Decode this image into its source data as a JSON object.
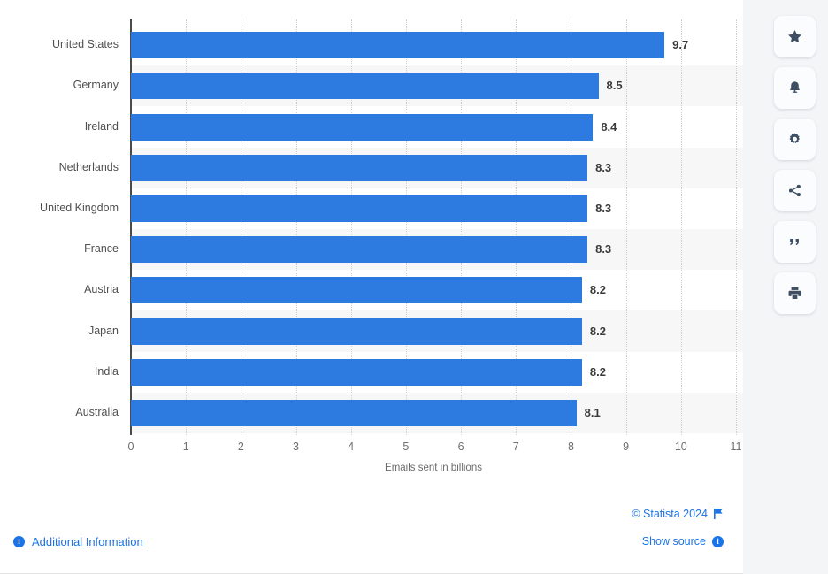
{
  "chart_data": {
    "type": "bar",
    "orientation": "horizontal",
    "title": "",
    "xlabel": "Emails sent in billions",
    "ylabel": "",
    "xlim": [
      0,
      11
    ],
    "xticks": [
      "0",
      "1",
      "2",
      "3",
      "4",
      "5",
      "6",
      "7",
      "8",
      "9",
      "10",
      "11"
    ],
    "grid": "vertical-dotted",
    "legend": "none",
    "bar_color": "#2d7be0",
    "categories": [
      "United States",
      "Germany",
      "Ireland",
      "Netherlands",
      "United Kingdom",
      "France",
      "Austria",
      "Japan",
      "India",
      "Australia"
    ],
    "values": [
      9.7,
      8.5,
      8.4,
      8.3,
      8.3,
      8.3,
      8.2,
      8.2,
      8.2,
      8.1
    ],
    "value_labels": [
      "9.7",
      "8.5",
      "8.4",
      "8.3",
      "8.3",
      "8.3",
      "8.2",
      "8.2",
      "8.2",
      "8.1"
    ]
  },
  "footer": {
    "copyright": "© Statista 2024",
    "flag_icon": "flag-icon",
    "show_source": "Show source",
    "show_source_icon": "info-icon",
    "additional_information": "Additional Information",
    "additional_information_icon": "info-icon",
    "link_color": "#1a73e8"
  },
  "toolbar": {
    "buttons": [
      {
        "name": "favorite-button",
        "icon": "star-icon"
      },
      {
        "name": "alert-button",
        "icon": "bell-icon"
      },
      {
        "name": "settings-button",
        "icon": "gear-icon"
      },
      {
        "name": "share-button",
        "icon": "share-icon"
      },
      {
        "name": "cite-button",
        "icon": "quote-icon"
      },
      {
        "name": "print-button",
        "icon": "printer-icon"
      }
    ],
    "icon_color": "#3e4e63"
  }
}
